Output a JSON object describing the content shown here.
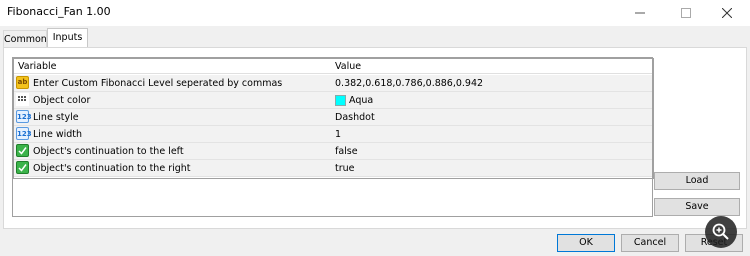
{
  "window": {
    "title": "Fibonacci_Fan 1.00",
    "controls": {
      "minimize": "minimize-icon",
      "maximize": "maximize-icon",
      "close": "close-icon"
    }
  },
  "tabs": [
    {
      "label": "Common",
      "selected": false
    },
    {
      "label": "Inputs",
      "selected": true
    }
  ],
  "grid": {
    "headers": {
      "variable": "Variable",
      "value": "Value"
    },
    "rows": [
      {
        "icon": "string-icon",
        "variable": "Enter Custom Fibonacci Level seperated by commas",
        "value": "0.382,0.618,0.786,0.886,0.942"
      },
      {
        "icon": "color-icon",
        "variable": "Object color",
        "value": "Aqua",
        "swatch": "#00ffff"
      },
      {
        "icon": "integer-icon",
        "variable": "Line style",
        "value": "Dashdot"
      },
      {
        "icon": "integer-icon",
        "variable": "Line width",
        "value": "1"
      },
      {
        "icon": "bool-icon",
        "variable": "Object's continuation to the left",
        "value": "false"
      },
      {
        "icon": "bool-icon",
        "variable": "Object's continuation to the right",
        "value": "true"
      }
    ]
  },
  "side_buttons": {
    "load": "Load",
    "save": "Save"
  },
  "footer_buttons": {
    "ok": "OK",
    "cancel": "Cancel",
    "reset": "Reset"
  },
  "icons": {
    "string": "ab",
    "integer": "123"
  },
  "colors": {
    "accent": "#0078d7",
    "swatch_aqua": "#00ffff"
  }
}
